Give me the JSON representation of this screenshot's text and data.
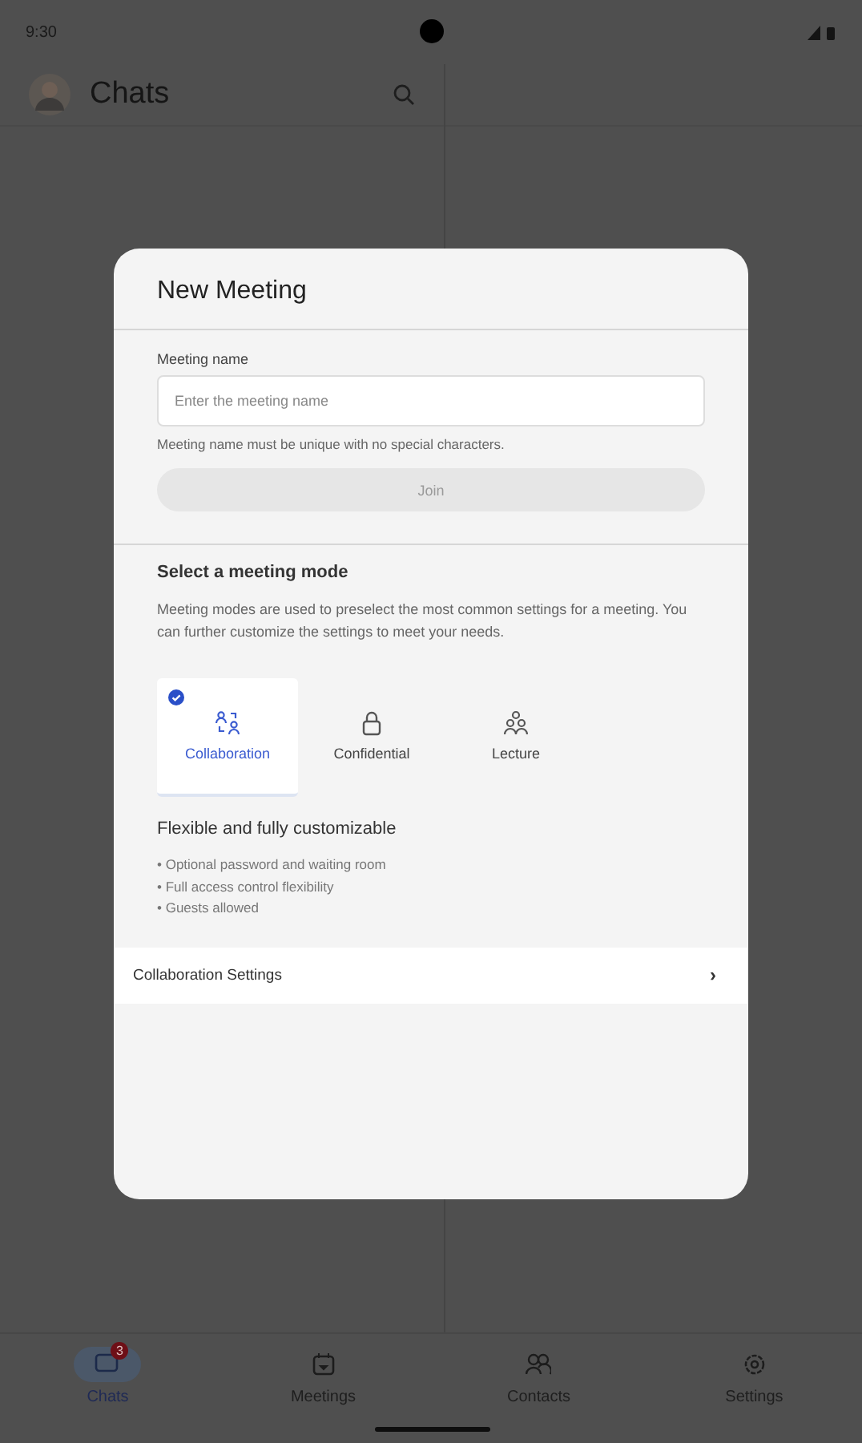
{
  "status_bar": {
    "time": "9:30"
  },
  "header": {
    "title": "Chats"
  },
  "dialog": {
    "title": "New Meeting",
    "name_field": {
      "label": "Meeting name",
      "placeholder": "Enter the meeting name",
      "hint": "Meeting name must be unique with no special characters."
    },
    "join_button": {
      "label": "Join",
      "disabled": true
    },
    "mode_section": {
      "title": "Select a meeting mode",
      "description": "Meeting modes are used to preselect the most common settings for a meeting. You can further customize the settings to meet your needs."
    },
    "modes": [
      {
        "label": "Collaboration",
        "selected": true
      },
      {
        "label": "Confidential",
        "selected": false
      },
      {
        "label": "Lecture",
        "selected": false
      }
    ],
    "mode_details": {
      "title": "Flexible and fully customizable",
      "bullets": [
        "• Optional password and waiting room",
        "• Full access control flexibility",
        "• Guests allowed"
      ]
    },
    "settings_row": {
      "label": "Collaboration Settings",
      "chevron": "›"
    }
  },
  "bottom_nav": [
    {
      "label": "Chats",
      "selected": true,
      "badge": "3"
    },
    {
      "label": "Meetings",
      "selected": false
    },
    {
      "label": "Contacts",
      "selected": false
    },
    {
      "label": "Settings",
      "selected": false
    }
  ]
}
